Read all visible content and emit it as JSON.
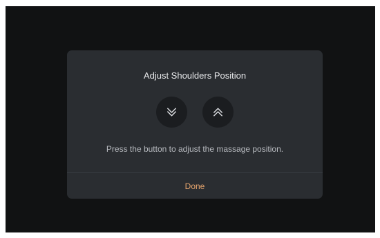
{
  "dialog": {
    "title": "Adjust Shoulders Position",
    "description": "Press the button to adjust the massage position.",
    "done_label": "Done",
    "down_icon": "double-chevron-down-icon",
    "up_icon": "double-chevron-up-icon"
  },
  "colors": {
    "background": "#111213",
    "dialog": "#2a2d31",
    "button": "#1b1d20",
    "accent": "#e5a46d"
  }
}
